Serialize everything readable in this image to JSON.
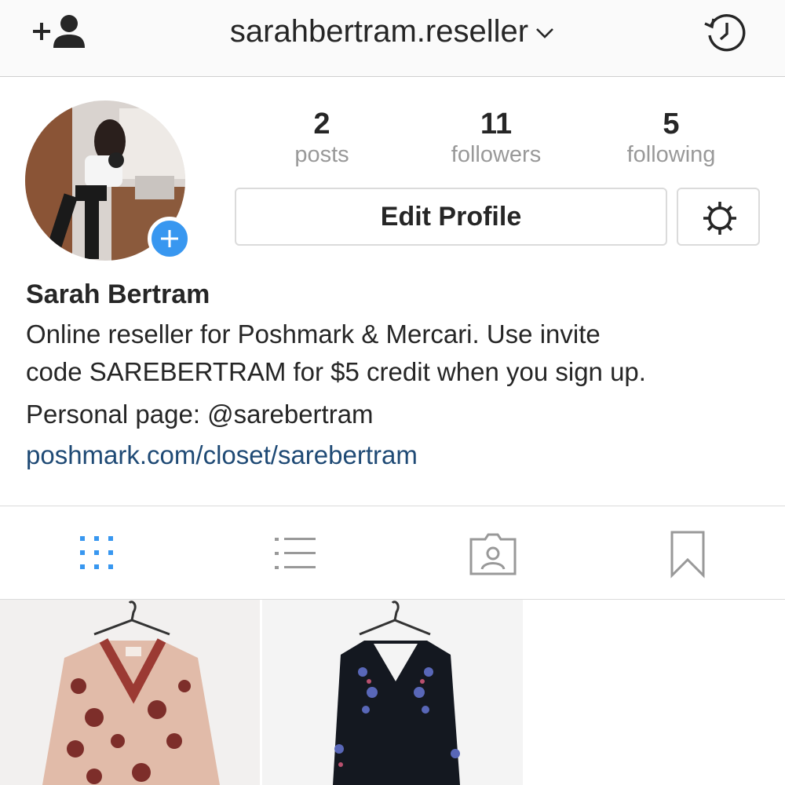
{
  "nav": {
    "username": "sarahbertram.reseller",
    "add_icon": "add-user-icon",
    "history_icon": "history-icon",
    "caret_icon": "chevron-down-icon"
  },
  "profile": {
    "stats": [
      {
        "count": "2",
        "label": "posts"
      },
      {
        "count": "11",
        "label": "followers"
      },
      {
        "count": "5",
        "label": "following"
      }
    ],
    "edit_label": "Edit Profile",
    "settings_icon": "gear-icon",
    "avatar_badge_icon": "plus-icon"
  },
  "bio": {
    "name": "Sarah Bertram",
    "line1": "Online reseller for Poshmark & Mercari. Use invite",
    "line2": "code SAREBERTRAM for $5 credit when you sign up.",
    "line3": "Personal page: @sarebertram",
    "link": "poshmark.com/closet/sarebertram"
  },
  "tabs": [
    {
      "icon": "grid-icon",
      "active": true
    },
    {
      "icon": "list-icon",
      "active": false
    },
    {
      "icon": "tagged-icon",
      "active": false
    },
    {
      "icon": "bookmark-icon",
      "active": false
    }
  ],
  "colors": {
    "accent": "#3897f0",
    "link": "#1f4a75",
    "muted": "#999999",
    "text": "#262626",
    "border": "#dbdbdb"
  }
}
